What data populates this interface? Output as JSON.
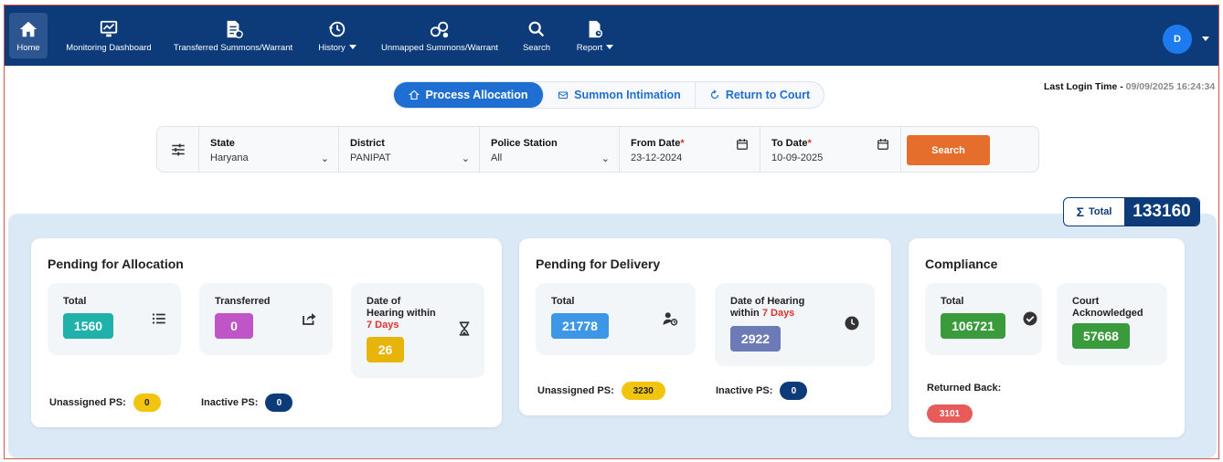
{
  "nav": {
    "items": [
      {
        "label": "Home"
      },
      {
        "label": "Monitoring Dashboard"
      },
      {
        "label": "Transferred Summons/Warrant"
      },
      {
        "label": "History"
      },
      {
        "label": "Unmapped Summons/Warrant"
      },
      {
        "label": "Search"
      },
      {
        "label": "Report"
      }
    ],
    "avatar_initial": "D"
  },
  "tabs": [
    {
      "label": "Process Allocation",
      "active": true
    },
    {
      "label": "Summon Intimation",
      "active": false
    },
    {
      "label": "Return to Court",
      "active": false
    }
  ],
  "last_login": {
    "label": "Last Login Time - ",
    "value": "09/09/2025 16:24:34"
  },
  "filters": {
    "state": {
      "label": "State",
      "value": "Haryana"
    },
    "district": {
      "label": "District",
      "value": "PANIPAT"
    },
    "police_station": {
      "label": "Police Station",
      "value": "All"
    },
    "from_date": {
      "label": "From Date",
      "required_mark": "*",
      "value": "23-12-2024"
    },
    "to_date": {
      "label": "To Date",
      "required_mark": "*",
      "value": "10-09-2025"
    },
    "search_label": "Search"
  },
  "grand_total": {
    "label": "Total",
    "value": "133160"
  },
  "pending_allocation": {
    "title": "Pending for Allocation",
    "total": {
      "label": "Total",
      "value": "1560"
    },
    "transferred": {
      "label": "Transferred",
      "value": "0"
    },
    "hearing": {
      "label_line1": "Date of",
      "label_line2": "Hearing within",
      "label_red": "7 Days",
      "value": "26"
    },
    "unassigned": {
      "label": "Unassigned PS:",
      "value": "0"
    },
    "inactive": {
      "label": "Inactive PS:",
      "value": "0"
    }
  },
  "pending_delivery": {
    "title": "Pending for Delivery",
    "total": {
      "label": "Total",
      "value": "21778"
    },
    "hearing": {
      "label_line1": "Date of Hearing",
      "label_line2": "within ",
      "label_red": "7 Days",
      "value": "2922"
    },
    "unassigned": {
      "label": "Unassigned PS:",
      "value": "3230"
    },
    "inactive": {
      "label": "Inactive PS:",
      "value": "0"
    }
  },
  "compliance": {
    "title": "Compliance",
    "total": {
      "label": "Total",
      "value": "106721"
    },
    "court_ack": {
      "label_line1": "Court",
      "label_line2": "Acknowledged",
      "value": "57668"
    },
    "returned": {
      "label": "Returned Back:",
      "value": "3101"
    }
  },
  "colors": {
    "navbar": "#0d3b7a",
    "teal": "#20b2aa",
    "magenta": "#c055c8",
    "amber": "#e7b50a",
    "blue": "#3d97e6",
    "slate": "#6c7bb5",
    "green": "#3a9b3c",
    "red_pill": "#e85b5b",
    "orange_button": "#e66e2c"
  }
}
